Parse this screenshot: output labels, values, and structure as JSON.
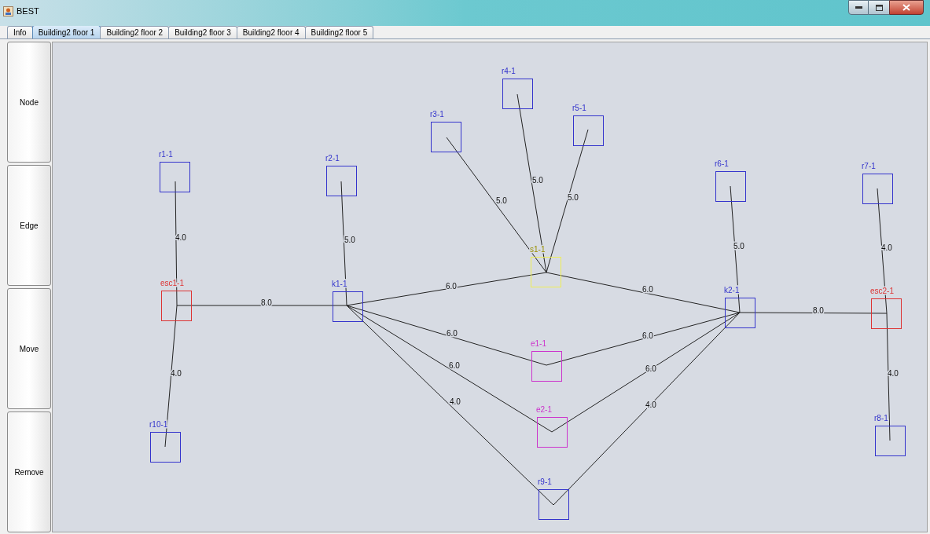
{
  "window": {
    "title": "BEST"
  },
  "tabs": [
    {
      "label": "Info",
      "selected": false
    },
    {
      "label": "Building2 floor 1",
      "selected": true
    },
    {
      "label": "Building2 floor 2",
      "selected": false
    },
    {
      "label": "Building2 floor 3",
      "selected": false
    },
    {
      "label": "Building2 floor 4",
      "selected": false
    },
    {
      "label": "Building2 floor 5",
      "selected": false
    }
  ],
  "tools": [
    "Node",
    "Edge",
    "Move",
    "Remove"
  ],
  "graph": {
    "nodes": [
      {
        "label": "r1-1",
        "color": "#3333cc"
      },
      {
        "label": "r2-1",
        "color": "#3333cc"
      },
      {
        "label": "r3-1",
        "color": "#3333cc"
      },
      {
        "label": "r4-1",
        "color": "#3333cc"
      },
      {
        "label": "r5-1",
        "color": "#3333cc"
      },
      {
        "label": "s1-1",
        "color": "#eeee55"
      },
      {
        "label": "r6-1",
        "color": "#3333cc"
      },
      {
        "label": "r7-1",
        "color": "#3333cc"
      },
      {
        "label": "esc1-1",
        "color": "#dd3333"
      },
      {
        "label": "k1-1",
        "color": "#3333cc"
      },
      {
        "label": "k2-1",
        "color": "#3333cc"
      },
      {
        "label": "esc2-1",
        "color": "#dd3333"
      },
      {
        "label": "e1-1",
        "color": "#cc33cc"
      },
      {
        "label": "e2-1",
        "color": "#cc33cc"
      },
      {
        "label": "r9-1",
        "color": "#3333cc"
      },
      {
        "label": "r10-1",
        "color": "#3333cc"
      },
      {
        "label": "r8-1",
        "color": "#3333cc"
      }
    ],
    "edges": [
      {
        "weight": "4.0"
      },
      {
        "weight": "4.0"
      },
      {
        "weight": "8.0"
      },
      {
        "weight": "5.0"
      },
      {
        "weight": "5.0"
      },
      {
        "weight": "5.0"
      },
      {
        "weight": "5.0"
      },
      {
        "weight": "6.0"
      },
      {
        "weight": "6.0"
      },
      {
        "weight": "6.0"
      },
      {
        "weight": "6.0"
      },
      {
        "weight": "6.0"
      },
      {
        "weight": "6.0"
      },
      {
        "weight": "4.0"
      },
      {
        "weight": "4.0"
      },
      {
        "weight": "5.0"
      },
      {
        "weight": "8.0"
      },
      {
        "weight": "4.0"
      },
      {
        "weight": "4.0"
      }
    ]
  }
}
